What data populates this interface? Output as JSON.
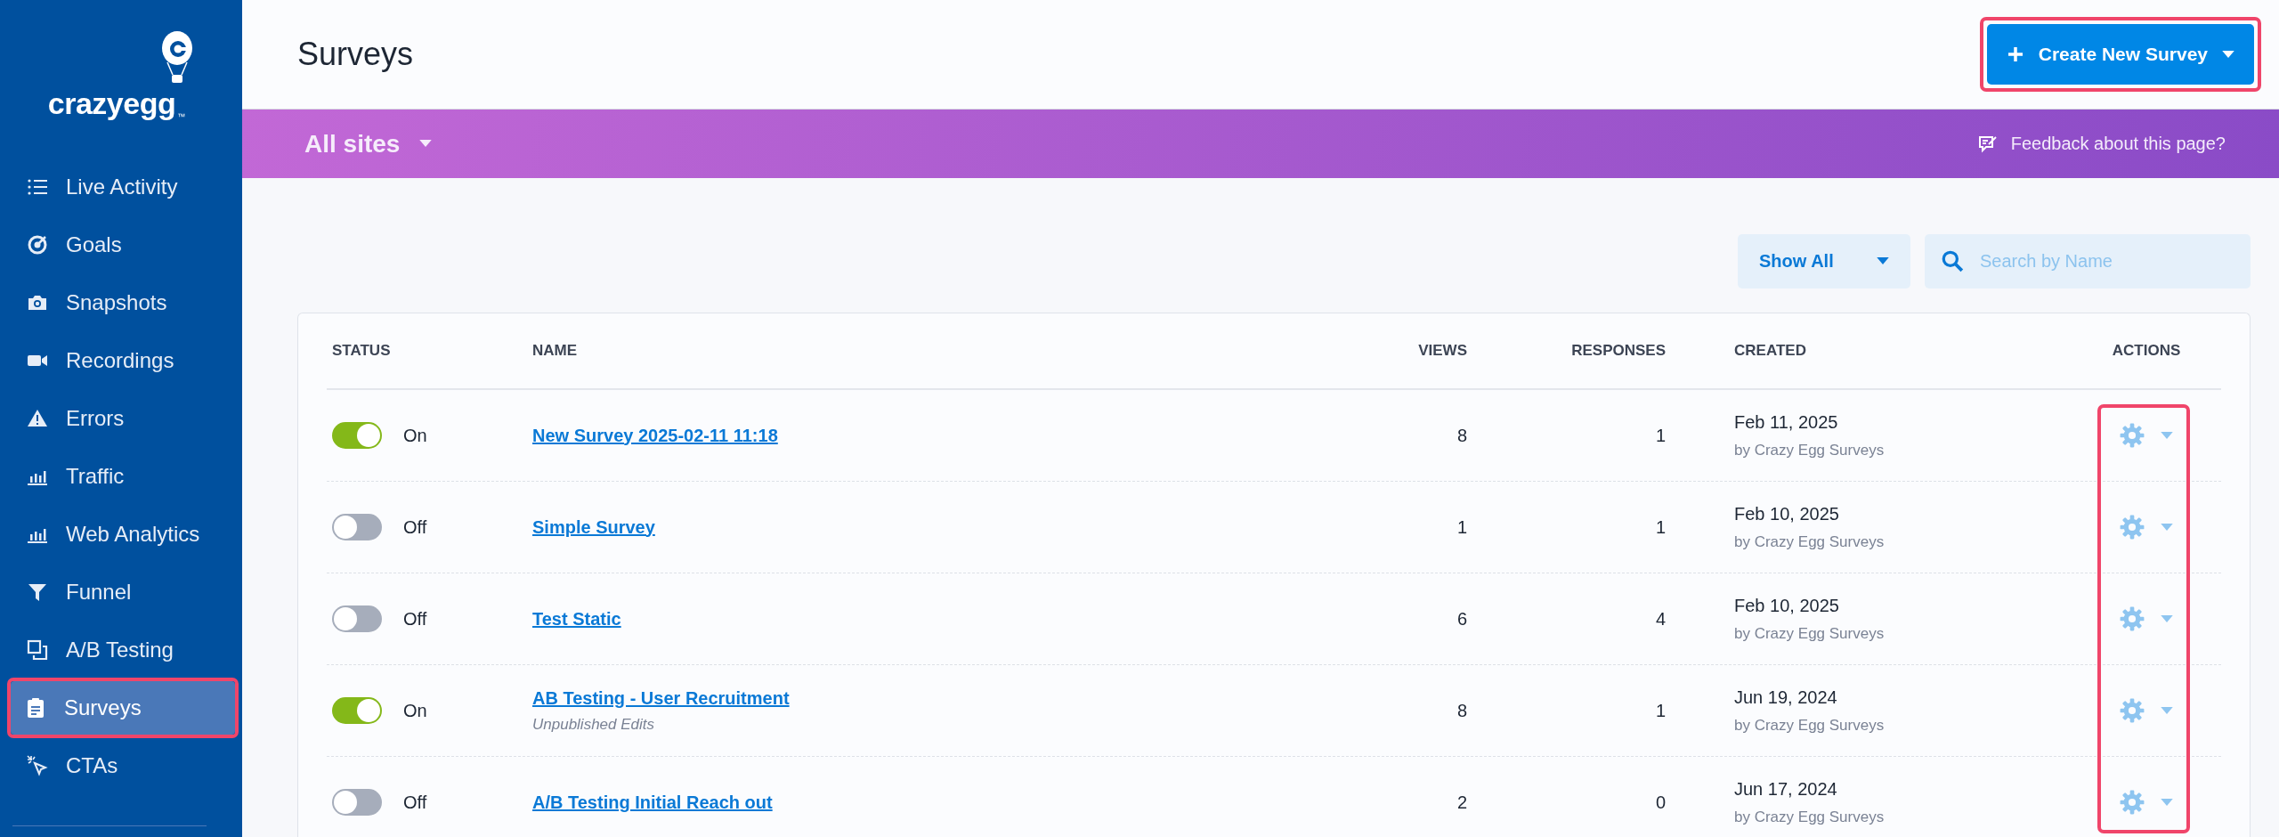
{
  "sidebar": {
    "logo": "crazyegg",
    "logo_tm": "™",
    "items": [
      {
        "label": "Live Activity",
        "selected": false,
        "highlighted": false
      },
      {
        "label": "Goals",
        "selected": false,
        "highlighted": false
      },
      {
        "label": "Snapshots",
        "selected": false,
        "highlighted": false
      },
      {
        "label": "Recordings",
        "selected": false,
        "highlighted": false
      },
      {
        "label": "Errors",
        "selected": false,
        "highlighted": false
      },
      {
        "label": "Traffic",
        "selected": false,
        "highlighted": false
      },
      {
        "label": "Web Analytics",
        "selected": false,
        "highlighted": false
      },
      {
        "label": "Funnel",
        "selected": false,
        "highlighted": false
      },
      {
        "label": "A/B Testing",
        "selected": false,
        "highlighted": false
      },
      {
        "label": "Surveys",
        "selected": true,
        "highlighted": true
      },
      {
        "label": "CTAs",
        "selected": false,
        "highlighted": false
      }
    ]
  },
  "header": {
    "title": "Surveys",
    "create_button": {
      "label": "Create New Survey",
      "highlighted": true
    }
  },
  "banner": {
    "site_selector": "All sites",
    "feedback_link": "Feedback about this page?"
  },
  "toolbar": {
    "filter": "Show All",
    "search": {
      "placeholder": "Search by Name"
    }
  },
  "table": {
    "columns": [
      "STATUS",
      "NAME",
      "VIEWS",
      "RESPONSES",
      "CREATED",
      "ACTIONS"
    ],
    "actions_highlighted": true,
    "rows": [
      {
        "on": true,
        "status": "On",
        "name": "New Survey 2025-02-11 11:18",
        "views": "8",
        "responses": "1",
        "created": "Feb 11, 2025",
        "created_by": "by Crazy Egg Surveys"
      },
      {
        "on": false,
        "status": "Off",
        "name": "Simple Survey",
        "views": "1",
        "responses": "1",
        "created": "Feb 10, 2025",
        "created_by": "by Crazy Egg Surveys"
      },
      {
        "on": false,
        "status": "Off",
        "name": "Test Static",
        "views": "6",
        "responses": "4",
        "created": "Feb 10, 2025",
        "created_by": "by Crazy Egg Surveys"
      },
      {
        "on": true,
        "status": "On",
        "name": "AB Testing - User Recruitment",
        "note": "Unpublished Edits",
        "views": "8",
        "responses": "1",
        "created": "Jun 19, 2024",
        "created_by": "by Crazy Egg Surveys"
      },
      {
        "on": false,
        "status": "Off",
        "name": "A/B Testing Initial Reach out",
        "views": "2",
        "responses": "0",
        "created": "Jun 17, 2024",
        "created_by": "by Crazy Egg Surveys"
      }
    ]
  }
}
